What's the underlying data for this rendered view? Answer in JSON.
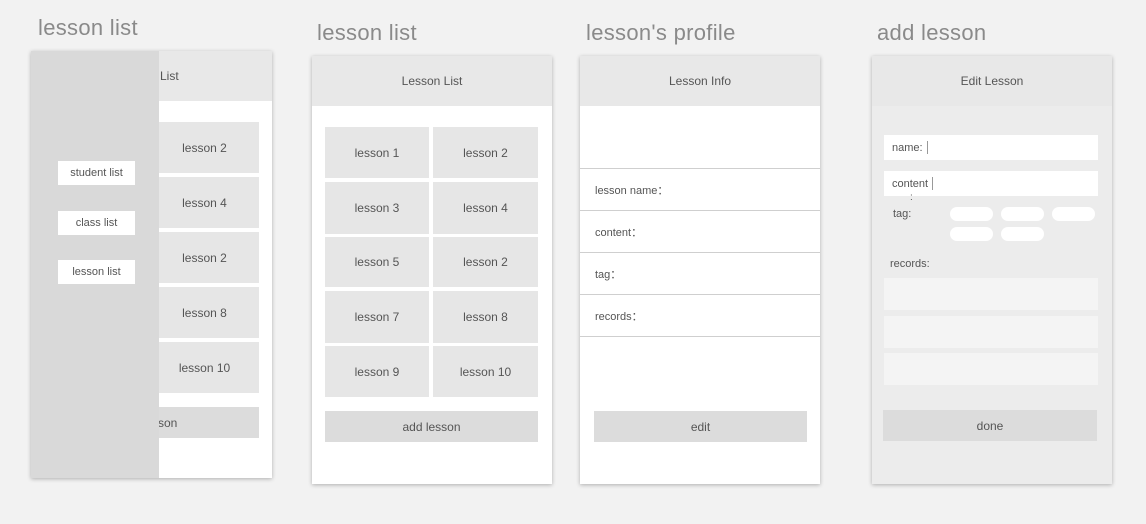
{
  "boards": [
    {
      "title": "lesson list"
    },
    {
      "title": "lesson list"
    },
    {
      "title": "lesson's profile"
    },
    {
      "title": "add lesson"
    }
  ],
  "screen1": {
    "header": "List",
    "tiles": [
      "lesson 2",
      "lesson 4",
      "lesson 2",
      "lesson 8",
      "lesson 10"
    ],
    "add_button": "son",
    "drawer_items": [
      "student list",
      "class list",
      "lesson list"
    ]
  },
  "screen2": {
    "header": "Lesson List",
    "tiles": [
      "lesson 1",
      "lesson 2",
      "lesson 3",
      "lesson 4",
      "lesson 5",
      "lesson 2",
      "lesson 7",
      "lesson 8",
      "lesson 9",
      "lesson 10"
    ],
    "add_button": "add lesson"
  },
  "screen3": {
    "header": "Lesson Info",
    "rows": [
      "lesson name：",
      "content：",
      "tag：",
      "records："
    ],
    "edit_button": "edit"
  },
  "screen4": {
    "header": "Edit Lesson",
    "name_label": "name:",
    "content_label": "content",
    "content_colon": ":",
    "tag_label": "tag:",
    "records_label": "records:",
    "done_button": "done"
  }
}
